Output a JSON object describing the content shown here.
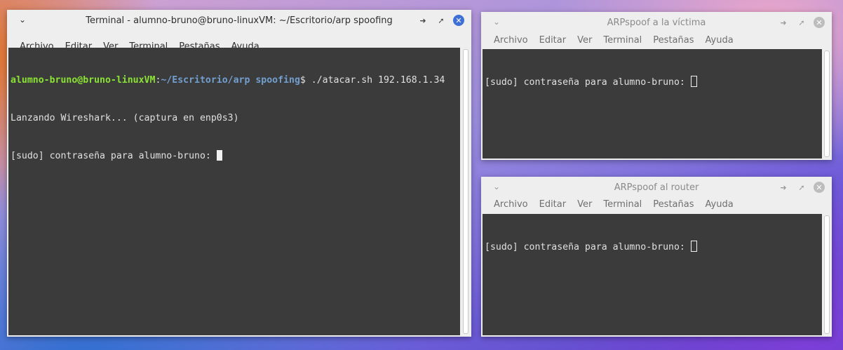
{
  "windows": {
    "main": {
      "title": "Terminal - alumno-bruno@bruno-linuxVM: ~/Escritorio/arp spoofing",
      "menu": [
        "Archivo",
        "Editar",
        "Ver",
        "Terminal",
        "Pestañas",
        "Ayuda"
      ],
      "prompt_user": "alumno-bruno@bruno-linuxVM",
      "prompt_colon": ":",
      "prompt_path": "~/Escritorio/arp spoofing",
      "prompt_dollar": "$ ",
      "command": "./atacar.sh 192.168.1.34",
      "output_line_1": "Lanzando Wireshark... (captura en enp0s3)",
      "output_line_2": "[sudo] contraseña para alumno-bruno: "
    },
    "victim": {
      "title": "ARPspoof a la víctima",
      "menu": [
        "Archivo",
        "Editar",
        "Ver",
        "Terminal",
        "Pestañas",
        "Ayuda"
      ],
      "output_line_1": "[sudo] contraseña para alumno-bruno: "
    },
    "router": {
      "title": "ARPspoof al router",
      "menu": [
        "Archivo",
        "Editar",
        "Ver",
        "Terminal",
        "Pestañas",
        "Ayuda"
      ],
      "output_line_1": "[sudo] contraseña para alumno-bruno: "
    }
  },
  "icons": {
    "window_menu": "chevron-down-icon",
    "minimize": "minimize-icon",
    "maximize": "maximize-icon",
    "close": "close-icon"
  },
  "colors": {
    "terminal_bg": "#3b3b3b",
    "prompt_user": "#8ae234",
    "prompt_path": "#729fcf",
    "close_active": "#3d6fd6"
  }
}
